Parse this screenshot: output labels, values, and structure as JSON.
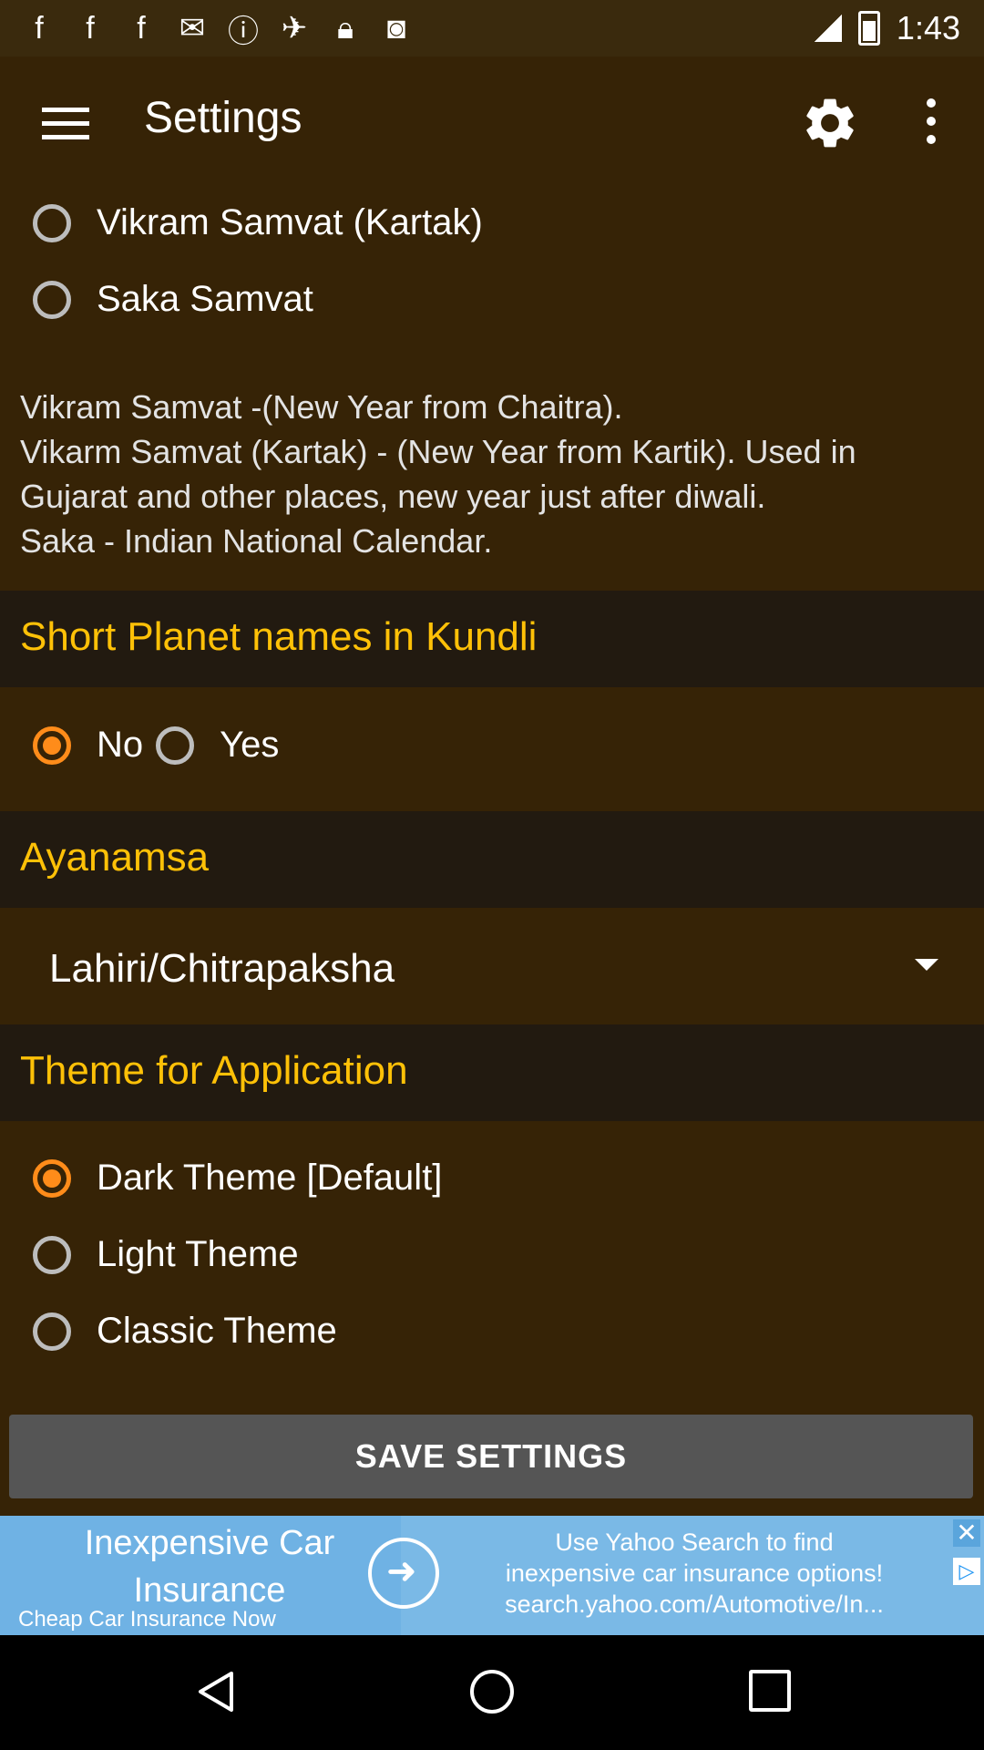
{
  "status_bar": {
    "time": "1:43",
    "icons": [
      "facebook-icon",
      "facebook-icon",
      "facebook-icon",
      "gmail-icon",
      "info-icon",
      "satellite-icon",
      "lock-icon",
      "android-icon"
    ]
  },
  "toolbar": {
    "title": "Settings"
  },
  "calendar_options": [
    {
      "label": "Vikram Samvat (Kartak)",
      "checked": false
    },
    {
      "label": "Saka Samvat",
      "checked": false
    }
  ],
  "calendar_description": "Vikram Samvat -(New Year from Chaitra).\nVikarm Samvat (Kartak) - (New Year from Kartik). Used in Gujarat and other places, new year just after diwali.\nSaka - Indian National Calendar.",
  "short_planet": {
    "header": "Short Planet names in Kundli",
    "options": [
      {
        "label": "No",
        "checked": true
      },
      {
        "label": "Yes",
        "checked": false
      }
    ]
  },
  "ayanamsa": {
    "header": "Ayanamsa",
    "selected": "Lahiri/Chitrapaksha"
  },
  "theme": {
    "header": "Theme for Application",
    "options": [
      {
        "label": "Dark Theme [Default]",
        "checked": true
      },
      {
        "label": "Light Theme",
        "checked": false
      },
      {
        "label": "Classic Theme",
        "checked": false
      }
    ]
  },
  "save_button": "SAVE SETTINGS",
  "ad": {
    "headline": "Inexpensive Car Insurance",
    "subline": "Cheap Car Insurance Now",
    "body_line1": "Use Yahoo Search to find",
    "body_line2": "inexpensive car insurance options!",
    "body_line3": "search.yahoo.com/Automotive/In...",
    "close_glyph": "✕"
  },
  "colors": {
    "background": "#362306",
    "section_header_bg": "#221a10",
    "accent": "#ffc107",
    "radio_checked": "#ff8c1a",
    "button_bg": "#555555"
  }
}
